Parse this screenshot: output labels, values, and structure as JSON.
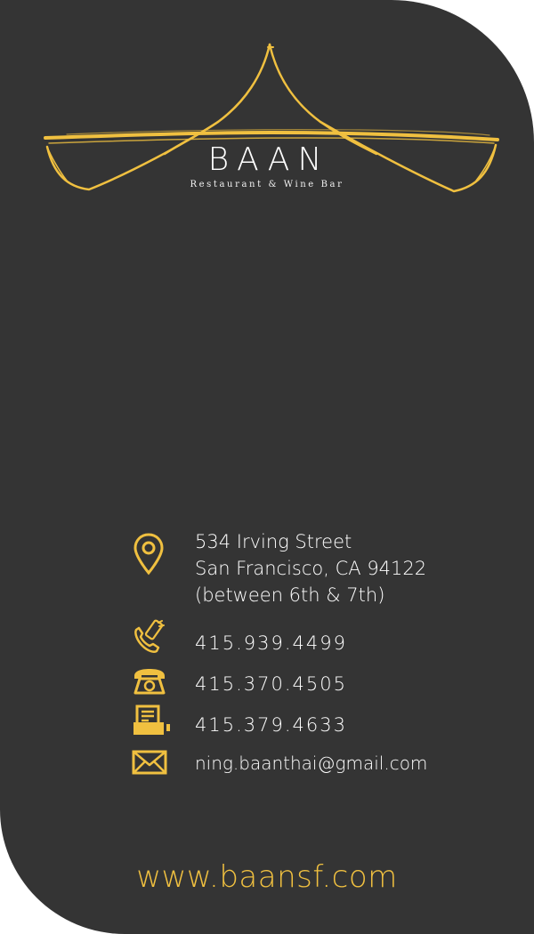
{
  "brand": {
    "name": "BAAN",
    "tagline": "Restaurant & Wine Bar"
  },
  "colors": {
    "background": "#343434",
    "accent": "#f0c040",
    "text": "#ffffff"
  },
  "contact": {
    "address": {
      "icon": "location-pin-icon",
      "line1": "534 Irving Street",
      "line2": "San Francisco, CA 94122",
      "line3": "(between 6th & 7th)"
    },
    "mobile": {
      "icon": "mobile-phone-icon",
      "value": "415.939.4499"
    },
    "phone": {
      "icon": "telephone-icon",
      "value": "415.370.4505"
    },
    "fax": {
      "icon": "fax-icon",
      "value": "415.379.4633"
    },
    "email": {
      "icon": "envelope-icon",
      "value": "ning.baanthai@gmail.com"
    }
  },
  "website": "www.baansf.com"
}
